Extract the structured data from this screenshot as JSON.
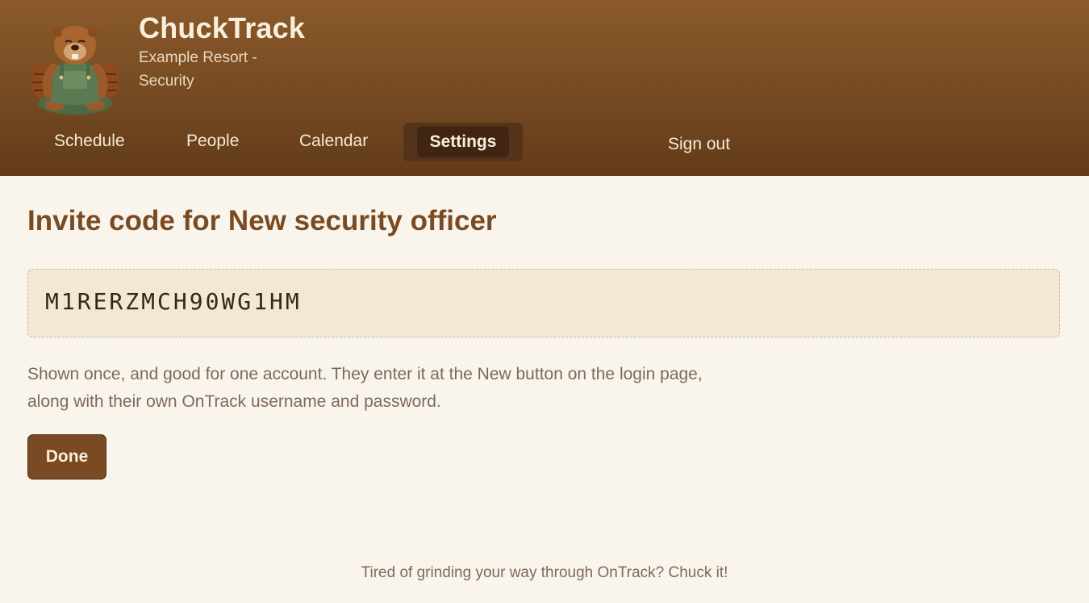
{
  "header": {
    "app_title": "ChuckTrack",
    "org_name": "Example Resort - Security",
    "logo_icon": "beaver-mascot-icon"
  },
  "nav": {
    "items": [
      {
        "label": "Schedule",
        "active": false
      },
      {
        "label": "People",
        "active": false
      },
      {
        "label": "Calendar",
        "active": false
      },
      {
        "label": "Settings",
        "active": true
      }
    ],
    "sign_out": "Sign out"
  },
  "main": {
    "title": "Invite code for New security officer",
    "invite_code": "M1RERZMCH90WG1HM",
    "help_text": "Shown once, and good for one account. They enter it at the New button on the login page, along with their own OnTrack username and password.",
    "done_label": "Done"
  },
  "footer": {
    "tagline": "Tired of grinding your way through OnTrack? Chuck it!"
  },
  "colors": {
    "header_top": "#8a5a2b",
    "header_bottom": "#633b1a",
    "accent": "#7a4a22",
    "background": "#faf5ec",
    "code_box": "#f2e8d6"
  }
}
